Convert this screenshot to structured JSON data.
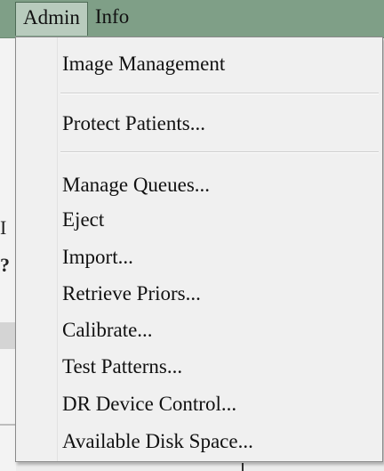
{
  "menubar": {
    "items": [
      {
        "label": "Admin"
      },
      {
        "label": "Info"
      }
    ]
  },
  "admin_menu": {
    "items": [
      {
        "label": "Image Management"
      },
      {
        "label": "Protect Patients..."
      },
      {
        "label": "Manage Queues..."
      },
      {
        "label": "Eject"
      },
      {
        "label": "Import..."
      },
      {
        "label": "Retrieve Priors..."
      },
      {
        "label": "Calibrate..."
      },
      {
        "label": "Test Patterns..."
      },
      {
        "label": "DR Device Control..."
      },
      {
        "label": "Available Disk Space..."
      }
    ]
  }
}
